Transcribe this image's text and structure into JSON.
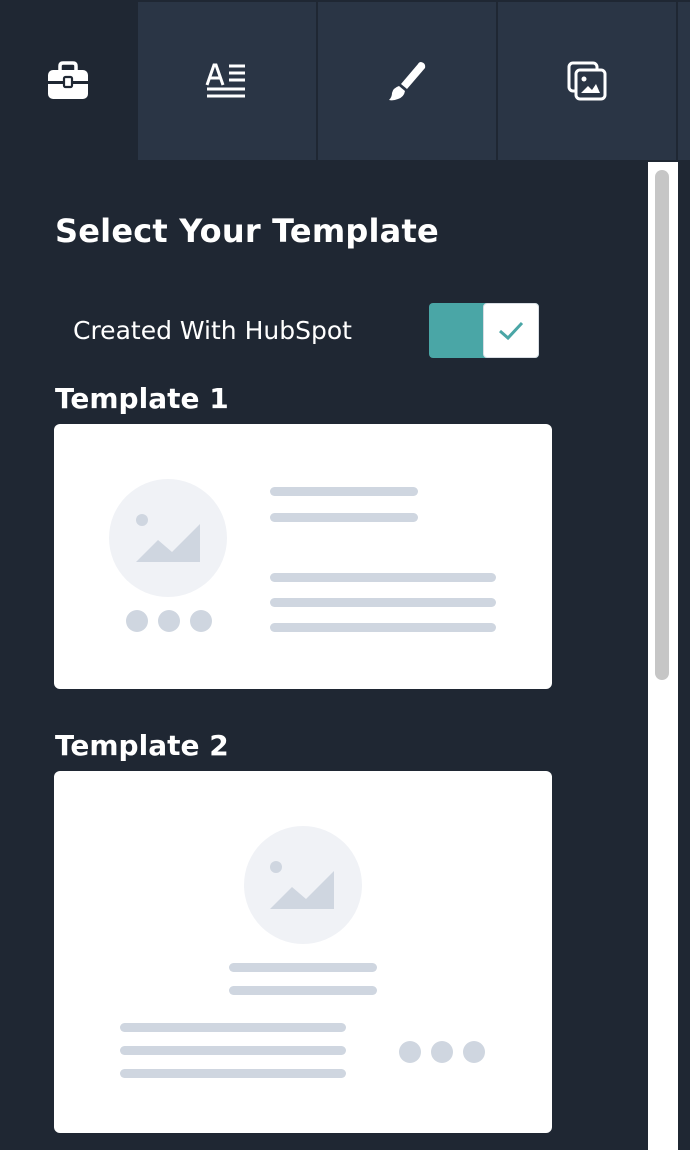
{
  "tabs": [
    {
      "id": "tools",
      "icon": "toolbox-icon",
      "active": true
    },
    {
      "id": "text-format",
      "icon": "text-format-icon",
      "active": false
    },
    {
      "id": "style",
      "icon": "brush-icon",
      "active": false
    },
    {
      "id": "media",
      "icon": "images-icon",
      "active": false
    }
  ],
  "panel": {
    "title": "Select Your Template",
    "toggle": {
      "label": "Created With HubSpot",
      "checked": true
    }
  },
  "templates": [
    {
      "label": "Template 1"
    },
    {
      "label": "Template 2"
    }
  ],
  "colors": {
    "background": "#1f2733",
    "tab_inactive": "#2a3545",
    "accent": "#4aa6a6",
    "placeholder": "#cfd6e0",
    "placeholder_circle": "#f0f2f6"
  }
}
